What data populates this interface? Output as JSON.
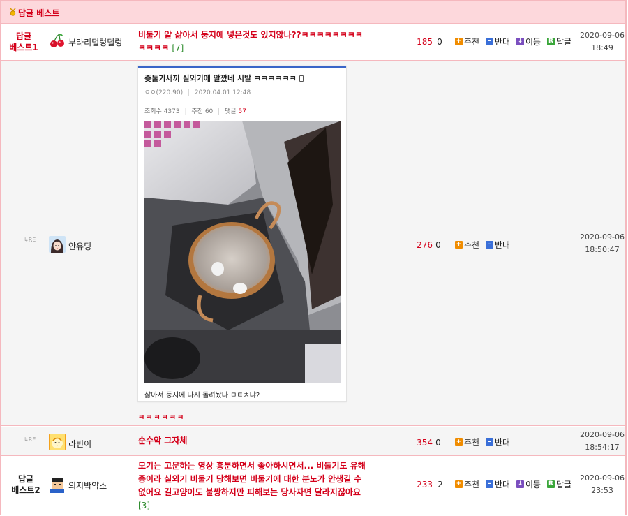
{
  "header": {
    "title": "답글 베스트",
    "medal_icon": "medal-icon"
  },
  "actions": {
    "recommend": "추천",
    "oppose": "반대",
    "move": "이동",
    "reply": "답글"
  },
  "colors": {
    "accent": "#d4001a",
    "border": "#f5b8be",
    "header_bg": "#fdd8dc",
    "count_green": "#2a8a2a"
  },
  "rows": [
    {
      "rank_line1": "답글",
      "rank_line2": "베스트1",
      "nickname": "부라리덜렁덜렁",
      "avatar_icon": "cherry-avatar",
      "content_line1": "비둘기 알 삶아서 둥지에 넣은것도 있지않나??ㅋㅋㅋㅋㅋㅋㅋㅋ",
      "content_line2": "ㅋㅋㅋㅋ",
      "comment_count": "[7]",
      "up": "185",
      "down": "0",
      "date": "2020-09-06",
      "time": "18:49"
    },
    {
      "re_label": "RE",
      "nickname": "안유딩",
      "avatar_icon": "girl-avatar",
      "embedded": {
        "title": "좆둘기새끼 실외기에 알깠네 시발 ㅋㅋㅋㅋㅋㅋ",
        "meta_author": "ㅇㅇ(220.90)",
        "meta_date": "2020.04.01 12:48",
        "views": "조회수 4373",
        "recs": "추천 60",
        "comments_label": "댓글",
        "comments": "57",
        "caption": "삶아서 둥지에 다시 돌려놨다 ㅁㅌㅊ냐?"
      },
      "extra_text": "ㅋㅋㅋㅋㅋㅋ",
      "up": "276",
      "down": "0",
      "date": "2020-09-06",
      "time": "18:50:47"
    },
    {
      "re_label": "RE",
      "nickname": "라빈이",
      "avatar_icon": "chick-avatar",
      "content_line1": "순수악 그자체",
      "up": "354",
      "down": "0",
      "date": "2020-09-06",
      "time": "18:54:17"
    },
    {
      "rank_line1": "답글",
      "rank_line2": "베스트2",
      "nickname": "의지박약소",
      "avatar_icon": "pixel-person-avatar",
      "content_lines": [
        "모기는 고문하는 영상 흥분하면서 좋아하시면서... 비둘기도 유해",
        "종이라 실외기 비둘기 당해보면 비둘기에 대한 분노가 안생길 수",
        "없어요 길고양이도 불쌍하지만 피해보는 당사자면 달라지잖아요"
      ],
      "comment_count": "[3]",
      "up": "233",
      "down": "2",
      "date": "2020-09-06",
      "time": "23:53"
    }
  ]
}
